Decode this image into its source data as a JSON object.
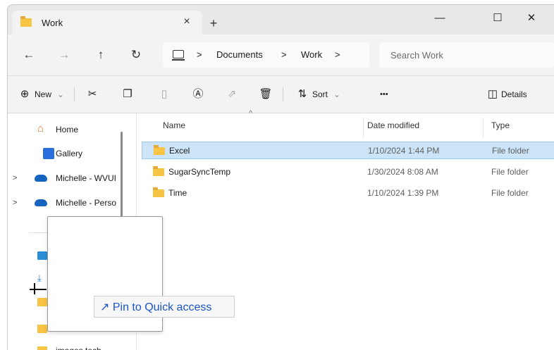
{
  "window": {
    "tab_title": "Work",
    "tab_close": "×",
    "new_tab": "+",
    "minimize": "—",
    "maximize": "☐",
    "close": "✕"
  },
  "nav": {
    "back": "←",
    "forward": "→",
    "up": "↑",
    "refresh": "↻",
    "breadcrumb": [
      ">",
      "Documents",
      ">",
      "Work",
      ">"
    ],
    "search_placeholder": "Search Work"
  },
  "toolbar": {
    "new_label": "New",
    "new_chevron": "⌄",
    "sort_label": "Sort",
    "sort_chevron": "⌄",
    "more": "•••",
    "details_label": "Details"
  },
  "sidebar": {
    "items": [
      {
        "label": "Home"
      },
      {
        "label": "Gallery"
      },
      {
        "label": "Michelle - WVUI",
        "chevron": ">"
      },
      {
        "label": "Michelle - Perso",
        "chevron": ">"
      },
      {
        "label": "images tech"
      }
    ]
  },
  "columns": {
    "name": "Name",
    "date": "Date modified",
    "type": "Type"
  },
  "files": [
    {
      "name": "Excel",
      "date": "1/10/2024 1:44 PM",
      "type": "File folder",
      "selected": true
    },
    {
      "name": "SugarSyncTemp",
      "date": "1/30/2024 8:08 AM",
      "type": "File folder",
      "selected": false
    },
    {
      "name": "Time",
      "date": "1/10/2024 1:39 PM",
      "type": "File folder",
      "selected": false
    }
  ],
  "drag_tooltip": "↗ Pin to Quick access",
  "colors": {
    "selection": "#cce4f7",
    "folder": "#f7c443",
    "accent": "#1a56c9"
  }
}
